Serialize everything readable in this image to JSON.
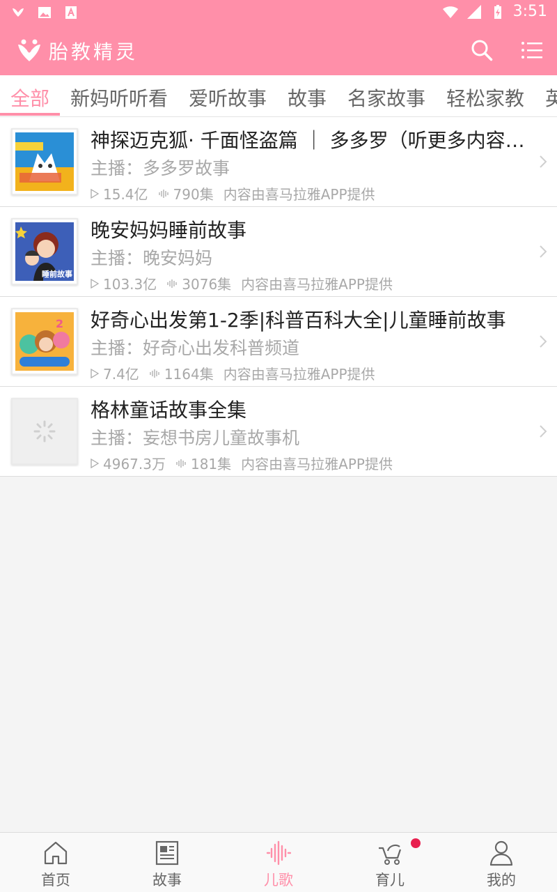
{
  "status_bar": {
    "time": "3:51"
  },
  "app_bar": {
    "title": "胎教精灵"
  },
  "tabs": [
    {
      "label": "全部",
      "active": true
    },
    {
      "label": "新妈听听看"
    },
    {
      "label": "爱听故事"
    },
    {
      "label": "故事"
    },
    {
      "label": "名家故事"
    },
    {
      "label": "轻松家教"
    },
    {
      "label": "英"
    }
  ],
  "list": [
    {
      "title": "神探迈克狐· 千面怪盗篇 ｜ 多多罗（听更多内容…",
      "anchor": "主播：多多罗故事",
      "plays": "15.4亿",
      "episodes": "790集",
      "source": "内容由喜马拉雅APP提供"
    },
    {
      "title": "晚安妈妈睡前故事",
      "anchor": "主播：晚安妈妈",
      "plays": "103.3亿",
      "episodes": "3076集",
      "source": "内容由喜马拉雅APP提供",
      "cover_text": "睡前故事"
    },
    {
      "title": "好奇心出发第1-2季|科普百科大全|儿童睡前故事",
      "anchor": "主播：好奇心出发科普频道",
      "plays": "7.4亿",
      "episodes": "1164集",
      "source": "内容由喜马拉雅APP提供"
    },
    {
      "title": "格林童话故事全集",
      "anchor": "主播：妄想书房儿童故事机",
      "plays": "4967.3万",
      "episodes": "181集",
      "source": "内容由喜马拉雅APP提供"
    }
  ],
  "bottom_nav": [
    {
      "label": "首页",
      "icon": "home-icon"
    },
    {
      "label": "故事",
      "icon": "newspaper-icon"
    },
    {
      "label": "儿歌",
      "icon": "soundwave-icon",
      "active": true
    },
    {
      "label": "育儿",
      "icon": "stroller-icon",
      "badge": true
    },
    {
      "label": "我的",
      "icon": "person-icon"
    }
  ],
  "colors": {
    "accent": "#ff8fa9",
    "badge": "#e8204f"
  }
}
